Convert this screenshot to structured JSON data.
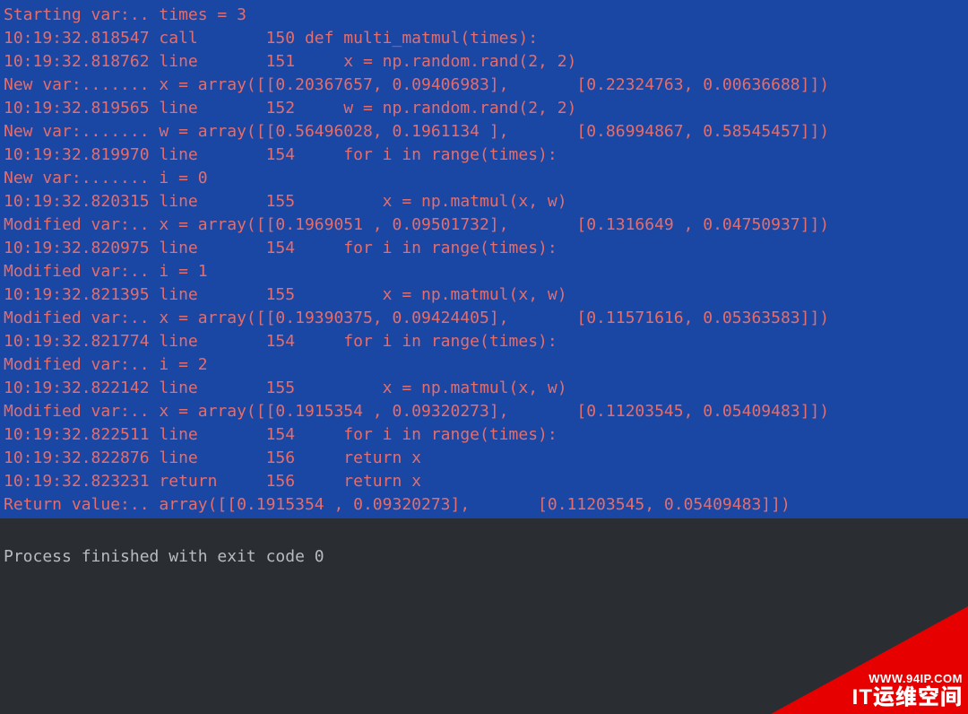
{
  "trace_lines": [
    "Starting var:.. times = 3",
    "10:19:32.818547 call       150 def multi_matmul(times):",
    "10:19:32.818762 line       151     x = np.random.rand(2, 2)",
    "New var:....... x = array([[0.20367657, 0.09406983],       [0.22324763, 0.00636688]])",
    "10:19:32.819565 line       152     w = np.random.rand(2, 2)",
    "New var:....... w = array([[0.56496028, 0.1961134 ],       [0.86994867, 0.58545457]])",
    "10:19:32.819970 line       154     for i in range(times):",
    "New var:....... i = 0",
    "10:19:32.820315 line       155         x = np.matmul(x, w)",
    "Modified var:.. x = array([[0.1969051 , 0.09501732],       [0.1316649 , 0.04750937]])",
    "10:19:32.820975 line       154     for i in range(times):",
    "Modified var:.. i = 1",
    "10:19:32.821395 line       155         x = np.matmul(x, w)",
    "Modified var:.. x = array([[0.19390375, 0.09424405],       [0.11571616, 0.05363583]])",
    "10:19:32.821774 line       154     for i in range(times):",
    "Modified var:.. i = 2",
    "10:19:32.822142 line       155         x = np.matmul(x, w)",
    "Modified var:.. x = array([[0.1915354 , 0.09320273],       [0.11203545, 0.05409483]])",
    "10:19:32.822511 line       154     for i in range(times):",
    "10:19:32.822876 line       156     return x",
    "10:19:32.823231 return     156     return x",
    "Return value:.. array([[0.1915354 , 0.09320273],       [0.11203545, 0.05409483]])"
  ],
  "status_line": "Process finished with exit code 0",
  "watermark": {
    "url": "WWW.94IP.COM",
    "label": "IT运维空间"
  }
}
